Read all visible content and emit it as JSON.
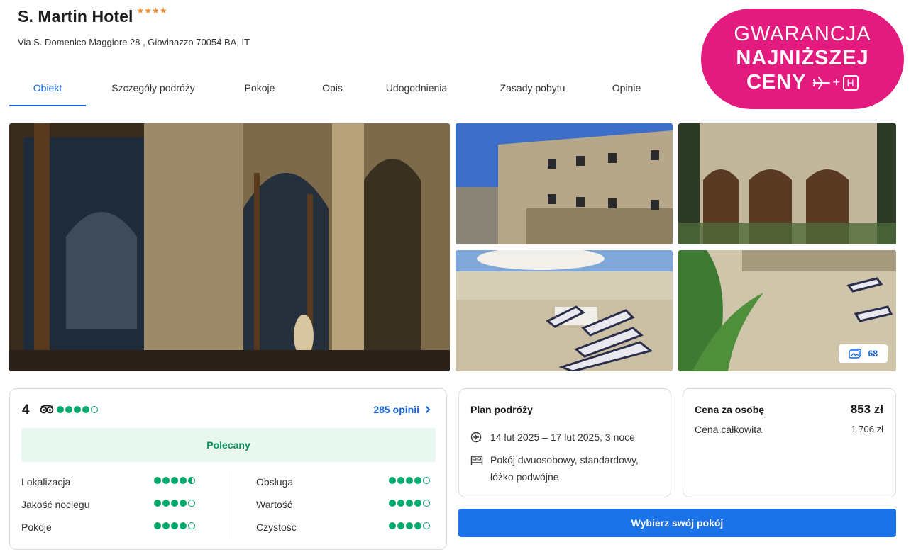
{
  "header": {
    "hotel_name": "S. Martin Hotel",
    "stars": "★★★★",
    "address": "Via S. Domenico Maggiore 28 , Giovinazzo 70054 BA, IT"
  },
  "tabs": [
    {
      "label": "Obiekt",
      "active": true
    },
    {
      "label": "Szczegóły podróży"
    },
    {
      "label": "Pokoje"
    },
    {
      "label": "Opis"
    },
    {
      "label": "Udogodnienia"
    },
    {
      "label": "Zasady pobytu"
    },
    {
      "label": "Opinie"
    }
  ],
  "badge": {
    "line1": "GWARANCJA",
    "line2": "NAJNIŻSZEJ",
    "line3": "CENY",
    "plus": "+",
    "hotel_letter": "H"
  },
  "gallery": {
    "photo_count": "68"
  },
  "rating": {
    "score": "4",
    "overall_dots": 4,
    "reviews_link": "285 opinii",
    "recommended": "Polecany",
    "categories": [
      {
        "label": "Lokalizacja",
        "score": 4.5
      },
      {
        "label": "Jakość noclegu",
        "score": 4
      },
      {
        "label": "Pokoje",
        "score": 4
      },
      {
        "label": "Obsługa",
        "score": 4
      },
      {
        "label": "Wartość",
        "score": 4
      },
      {
        "label": "Czystość",
        "score": 4
      }
    ]
  },
  "plan": {
    "title": "Plan podróży",
    "dates": "14 lut 2025 – 17 lut 2025, 3 noce",
    "room_line1": "Pokój dwuosobowy, standardowy,",
    "room_line2": "łóżko podwójne"
  },
  "price": {
    "per_person_label": "Cena za osobę",
    "per_person_value": "853 zł",
    "total_label": "Cena całkowita",
    "total_value": "1 706 zł"
  },
  "cta": {
    "label": "Wybierz swój pokój"
  },
  "colors": {
    "accent": "#1565d8",
    "badge": "#e31b7e",
    "tripadvisor": "#00aa6c",
    "cta": "#1a73e8"
  }
}
